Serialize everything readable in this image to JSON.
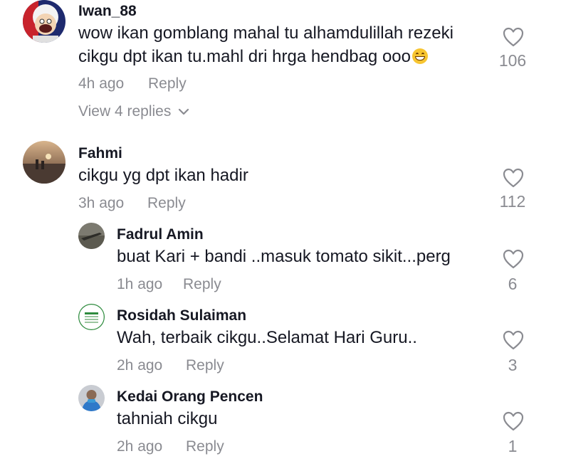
{
  "comments": [
    {
      "username": "Iwan_88",
      "text_line1": "wow ikan gomblang mahal tu alhamdulillah rezeki",
      "text_line2": "cikgu dpt ikan tu.mahl dri hrga hendbag ooo",
      "emoji": "grinning-face-emoji",
      "time": "4h ago",
      "reply_label": "Reply",
      "likes": "106",
      "view_replies": "View 4 replies"
    },
    {
      "username": "Fahmi",
      "text": "cikgu yg dpt ikan hadir",
      "time": "3h ago",
      "reply_label": "Reply",
      "likes": "112",
      "replies": [
        {
          "username": "Fadrul Amin",
          "text": "buat Kari + bandi ..masuk tomato sikit...perg",
          "time": "1h ago",
          "reply_label": "Reply",
          "likes": "6"
        },
        {
          "username": "Rosidah Sulaiman",
          "text": "Wah, terbaik cikgu..Selamat Hari Guru..",
          "time": "2h ago",
          "reply_label": "Reply",
          "likes": "3"
        },
        {
          "username": "Kedai Orang Pencen",
          "text": "tahniah cikgu",
          "time": "2h ago",
          "reply_label": "Reply",
          "likes": "1"
        }
      ]
    }
  ],
  "icons": {
    "like": "heart-outline-icon",
    "expand": "chevron-down-icon"
  },
  "colors": {
    "primary_text": "#161823",
    "secondary_text": "#8a8b91",
    "background": "#ffffff"
  }
}
